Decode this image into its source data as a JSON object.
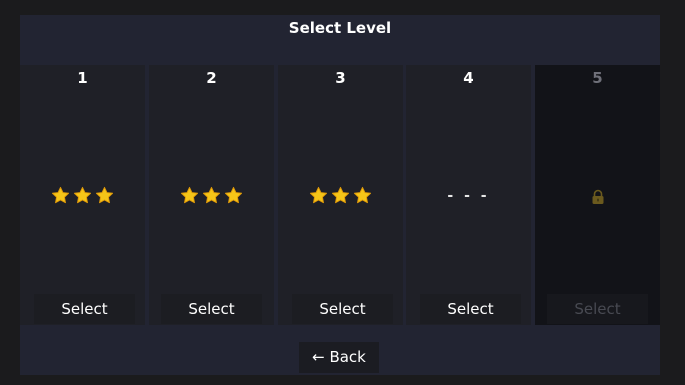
{
  "header": {
    "title": "Select Level"
  },
  "colors": {
    "star": "#f5c518",
    "lock": "#6b5a1e",
    "frame": "#222432",
    "card": "#1f2027",
    "card_locked": "#121318"
  },
  "levels": [
    {
      "number": "1",
      "stars": 3,
      "select_label": "Select",
      "locked": false
    },
    {
      "number": "2",
      "stars": 3,
      "select_label": "Select",
      "locked": false
    },
    {
      "number": "3",
      "stars": 3,
      "select_label": "Select",
      "locked": false
    },
    {
      "number": "4",
      "stars_text": "- - -",
      "select_label": "Select",
      "locked": false
    },
    {
      "number": "5",
      "icon": "lock-icon",
      "select_label": "Select",
      "locked": true
    }
  ],
  "footer": {
    "back_label": "← Back"
  }
}
